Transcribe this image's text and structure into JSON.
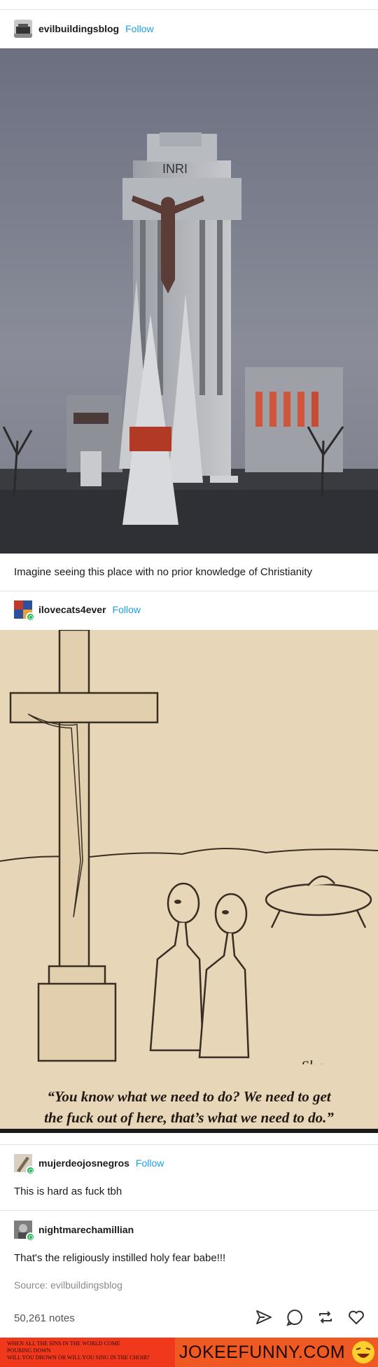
{
  "posts": [
    {
      "username": "evilbuildingsblog",
      "follow_label": "Follow",
      "image_alt": "Monumental cross building with crucifix and INRI sign",
      "inri": "INRI",
      "caption_text": "Imagine seeing this place with no prior knowledge of Christianity"
    },
    {
      "username": "ilovecats4ever",
      "follow_label": "Follow",
      "cartoon_caption_line1": "“You know what we need to do? We need to get",
      "cartoon_caption_line2": "the fuck out of here, that’s what we need to do.”",
      "signature": "Shaw"
    },
    {
      "username": "mujerdeojosnegros",
      "follow_label": "Follow",
      "text": "This is hard as fuck tbh"
    },
    {
      "username": "nightmarechamillian",
      "text": "That's the religiously instilled holy fear babe!!!",
      "source": "Source: evilbuildingsblog"
    }
  ],
  "footer": {
    "notes": "50,261 notes",
    "icons": [
      "share-icon",
      "reply-icon",
      "reblog-icon",
      "like-icon"
    ]
  },
  "ad": {
    "line1": "WHEN ALL THE SINS IN THE WORLD COME",
    "line2": "POURING DOWN",
    "line3": "WILL YOU DROWN OR WILL YOU SING IN THE CHOIR?",
    "brand": "JOKEEFUNNY.COM"
  },
  "colors": {
    "follow": "#1da1e6",
    "reblog_badge": "#1db954",
    "ad_background": "#f0381c"
  }
}
